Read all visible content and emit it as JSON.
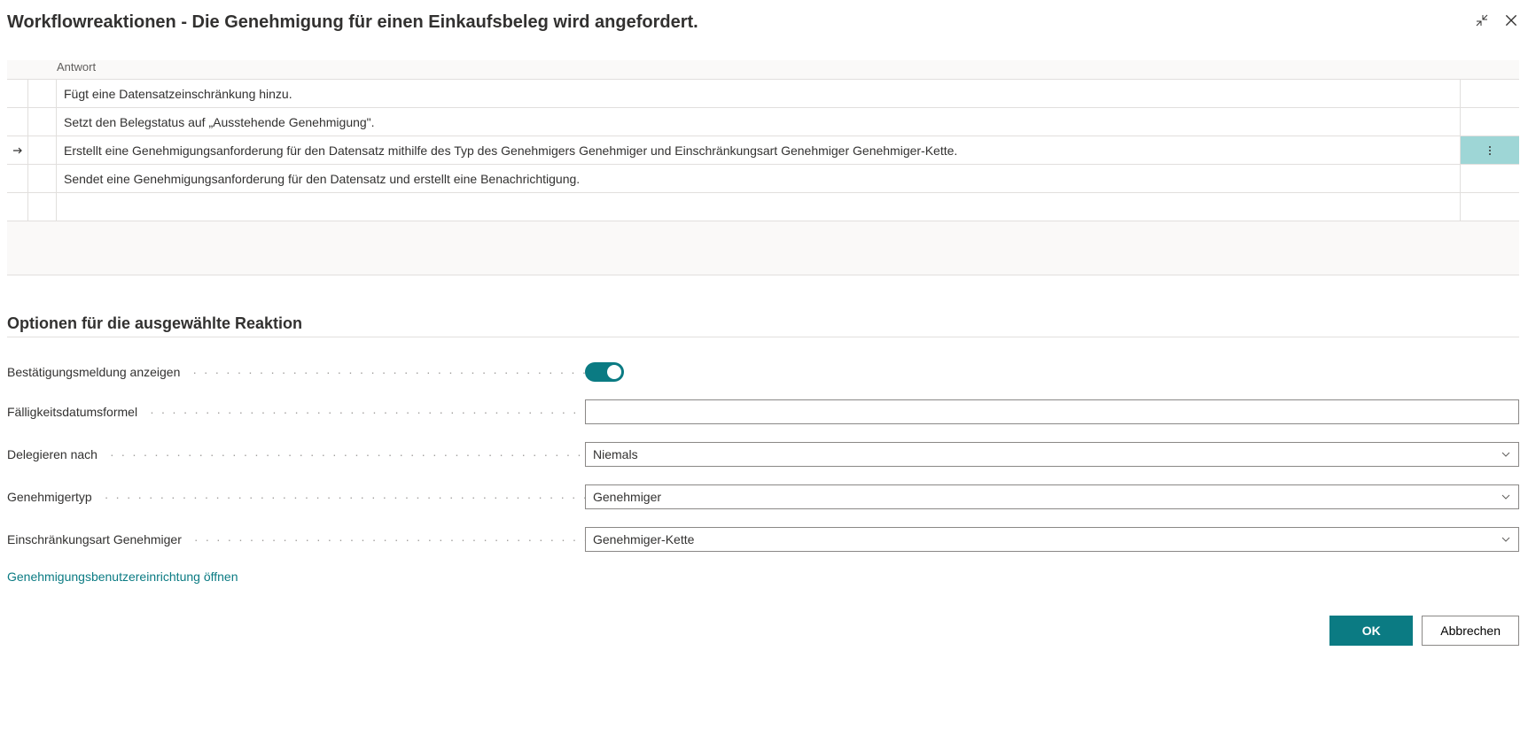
{
  "header": {
    "title": "Workflowreaktionen - Die Genehmigung für einen Einkaufsbeleg wird angefordert."
  },
  "table": {
    "columns": {
      "antwort": "Antwort"
    },
    "rows": [
      {
        "text": "Fügt eine Datensatzeinschränkung hinzu.",
        "selected": false
      },
      {
        "text": "Setzt den Belegstatus auf „Ausstehende Genehmigung\".",
        "selected": false
      },
      {
        "text": "Erstellt eine Genehmigungsanforderung für den Datensatz mithilfe des Typ des Genehmigers Genehmiger und Einschränkungsart Genehmiger Genehmiger-Kette.",
        "selected": true
      },
      {
        "text": "Sendet eine Genehmigungsanforderung für den Datensatz und erstellt eine Benachrichtigung.",
        "selected": false
      },
      {
        "text": "",
        "selected": false
      }
    ]
  },
  "options": {
    "heading": "Optionen für die ausgewählte Reaktion",
    "fields": {
      "confirm_label": "Bestätigungsmeldung anzeigen",
      "confirm_value": true,
      "duedate_label": "Fälligkeitsdatumsformel",
      "duedate_value": "",
      "delegate_label": "Delegieren nach",
      "delegate_value": "Niemals",
      "approver_type_label": "Genehmigertyp",
      "approver_type_value": "Genehmiger",
      "limit_type_label": "Einschränkungsart Genehmiger",
      "limit_type_value": "Genehmiger-Kette"
    },
    "link": "Genehmigungsbenutzereinrichtung öffnen"
  },
  "footer": {
    "ok": "OK",
    "cancel": "Abbrechen"
  }
}
